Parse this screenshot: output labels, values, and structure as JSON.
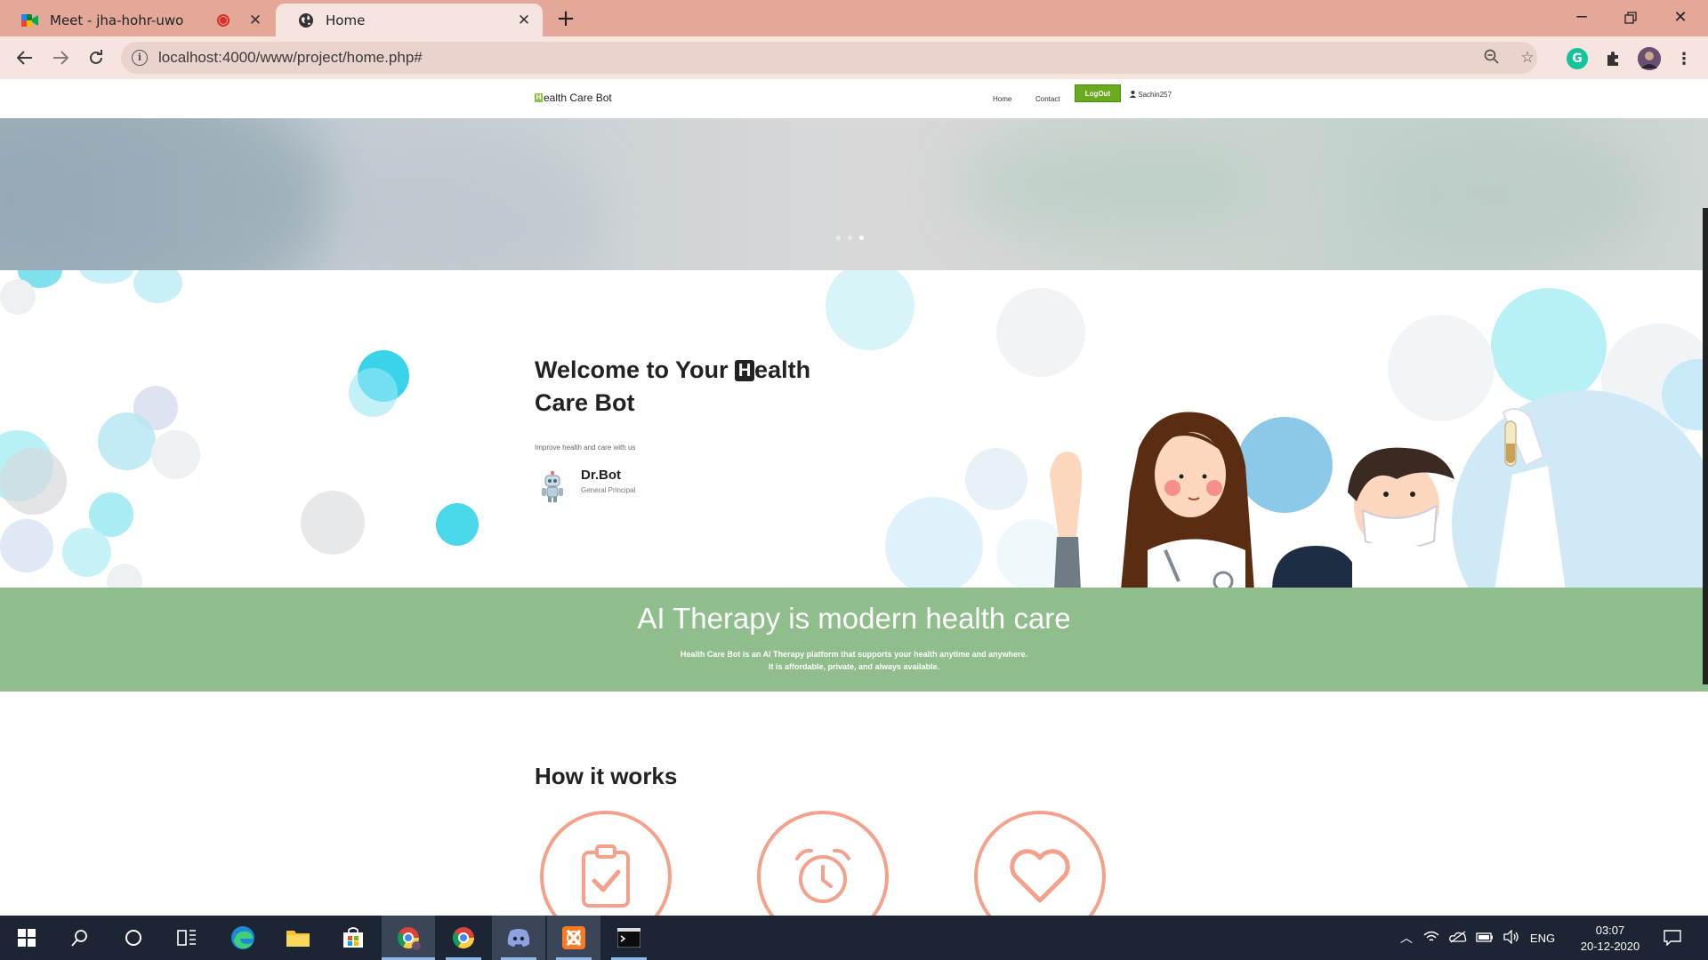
{
  "browser": {
    "tabs": [
      {
        "title": "Meet - jha-hohr-uwo",
        "active": false
      },
      {
        "title": "Home",
        "active": true
      }
    ],
    "url": "localhost:4000/www/project/home.php#"
  },
  "site": {
    "brand_letter": "H",
    "brand_rest": "ealth Care Bot",
    "nav": {
      "home": "Home",
      "contact": "Contact",
      "logout": "LogOut",
      "user": "Sachin257"
    }
  },
  "welcome": {
    "title_before": "Welcome to Your ",
    "title_letter": "H",
    "title_after": "ealth Care Bot",
    "subtitle": "Improve health and care with us",
    "doctor_name": "Dr.Bot",
    "doctor_role": "General Principal"
  },
  "band": {
    "heading": "AI Therapy is modern health care",
    "line1": "Health Care Bot is an AI Therapy platform that supports your health anytime and anywhere.",
    "line2": "It is affordable, private, and always available."
  },
  "how": {
    "title": "How it works",
    "steps": [
      {
        "icon": "clipboard-check-icon"
      },
      {
        "icon": "alarm-clock-icon"
      },
      {
        "icon": "heart-icon"
      }
    ]
  },
  "taskbar": {
    "language": "ENG",
    "time": "03:07",
    "date": "20-12-2020"
  },
  "colors": {
    "tabstrip": "#e3a898",
    "logout": "#6aaa1e",
    "band": "#8fbd8b",
    "accent_circle": "#f4a08a",
    "taskbar": "#1c2533"
  }
}
